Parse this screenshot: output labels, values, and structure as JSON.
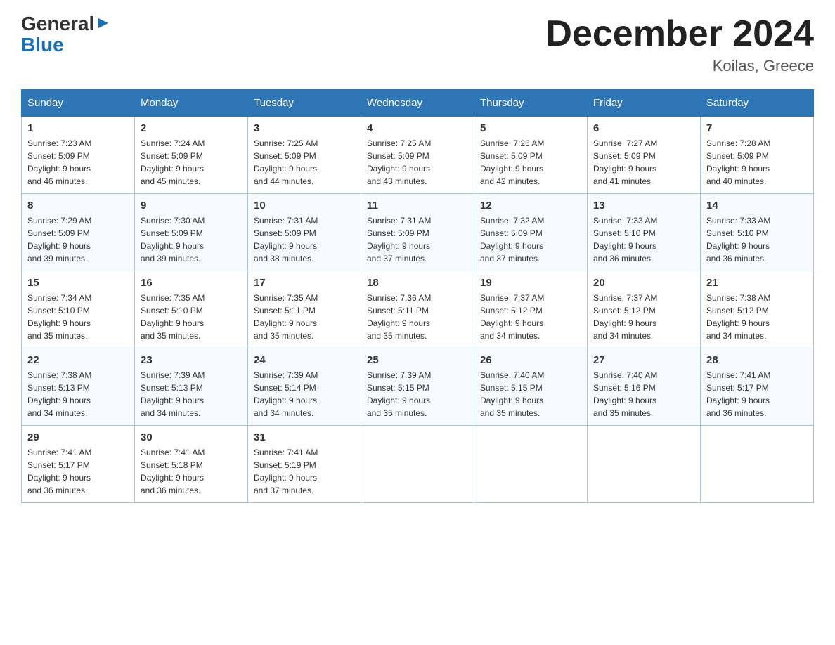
{
  "logo": {
    "part1": "General",
    "arrow": "▶",
    "part2": "Blue"
  },
  "title": "December 2024",
  "location": "Koilas, Greece",
  "days_of_week": [
    "Sunday",
    "Monday",
    "Tuesday",
    "Wednesday",
    "Thursday",
    "Friday",
    "Saturday"
  ],
  "weeks": [
    [
      {
        "day": "1",
        "sunrise": "7:23 AM",
        "sunset": "5:09 PM",
        "daylight": "9 hours and 46 minutes."
      },
      {
        "day": "2",
        "sunrise": "7:24 AM",
        "sunset": "5:09 PM",
        "daylight": "9 hours and 45 minutes."
      },
      {
        "day": "3",
        "sunrise": "7:25 AM",
        "sunset": "5:09 PM",
        "daylight": "9 hours and 44 minutes."
      },
      {
        "day": "4",
        "sunrise": "7:25 AM",
        "sunset": "5:09 PM",
        "daylight": "9 hours and 43 minutes."
      },
      {
        "day": "5",
        "sunrise": "7:26 AM",
        "sunset": "5:09 PM",
        "daylight": "9 hours and 42 minutes."
      },
      {
        "day": "6",
        "sunrise": "7:27 AM",
        "sunset": "5:09 PM",
        "daylight": "9 hours and 41 minutes."
      },
      {
        "day": "7",
        "sunrise": "7:28 AM",
        "sunset": "5:09 PM",
        "daylight": "9 hours and 40 minutes."
      }
    ],
    [
      {
        "day": "8",
        "sunrise": "7:29 AM",
        "sunset": "5:09 PM",
        "daylight": "9 hours and 39 minutes."
      },
      {
        "day": "9",
        "sunrise": "7:30 AM",
        "sunset": "5:09 PM",
        "daylight": "9 hours and 39 minutes."
      },
      {
        "day": "10",
        "sunrise": "7:31 AM",
        "sunset": "5:09 PM",
        "daylight": "9 hours and 38 minutes."
      },
      {
        "day": "11",
        "sunrise": "7:31 AM",
        "sunset": "5:09 PM",
        "daylight": "9 hours and 37 minutes."
      },
      {
        "day": "12",
        "sunrise": "7:32 AM",
        "sunset": "5:09 PM",
        "daylight": "9 hours and 37 minutes."
      },
      {
        "day": "13",
        "sunrise": "7:33 AM",
        "sunset": "5:10 PM",
        "daylight": "9 hours and 36 minutes."
      },
      {
        "day": "14",
        "sunrise": "7:33 AM",
        "sunset": "5:10 PM",
        "daylight": "9 hours and 36 minutes."
      }
    ],
    [
      {
        "day": "15",
        "sunrise": "7:34 AM",
        "sunset": "5:10 PM",
        "daylight": "9 hours and 35 minutes."
      },
      {
        "day": "16",
        "sunrise": "7:35 AM",
        "sunset": "5:10 PM",
        "daylight": "9 hours and 35 minutes."
      },
      {
        "day": "17",
        "sunrise": "7:35 AM",
        "sunset": "5:11 PM",
        "daylight": "9 hours and 35 minutes."
      },
      {
        "day": "18",
        "sunrise": "7:36 AM",
        "sunset": "5:11 PM",
        "daylight": "9 hours and 35 minutes."
      },
      {
        "day": "19",
        "sunrise": "7:37 AM",
        "sunset": "5:12 PM",
        "daylight": "9 hours and 34 minutes."
      },
      {
        "day": "20",
        "sunrise": "7:37 AM",
        "sunset": "5:12 PM",
        "daylight": "9 hours and 34 minutes."
      },
      {
        "day": "21",
        "sunrise": "7:38 AM",
        "sunset": "5:12 PM",
        "daylight": "9 hours and 34 minutes."
      }
    ],
    [
      {
        "day": "22",
        "sunrise": "7:38 AM",
        "sunset": "5:13 PM",
        "daylight": "9 hours and 34 minutes."
      },
      {
        "day": "23",
        "sunrise": "7:39 AM",
        "sunset": "5:13 PM",
        "daylight": "9 hours and 34 minutes."
      },
      {
        "day": "24",
        "sunrise": "7:39 AM",
        "sunset": "5:14 PM",
        "daylight": "9 hours and 34 minutes."
      },
      {
        "day": "25",
        "sunrise": "7:39 AM",
        "sunset": "5:15 PM",
        "daylight": "9 hours and 35 minutes."
      },
      {
        "day": "26",
        "sunrise": "7:40 AM",
        "sunset": "5:15 PM",
        "daylight": "9 hours and 35 minutes."
      },
      {
        "day": "27",
        "sunrise": "7:40 AM",
        "sunset": "5:16 PM",
        "daylight": "9 hours and 35 minutes."
      },
      {
        "day": "28",
        "sunrise": "7:41 AM",
        "sunset": "5:17 PM",
        "daylight": "9 hours and 36 minutes."
      }
    ],
    [
      {
        "day": "29",
        "sunrise": "7:41 AM",
        "sunset": "5:17 PM",
        "daylight": "9 hours and 36 minutes."
      },
      {
        "day": "30",
        "sunrise": "7:41 AM",
        "sunset": "5:18 PM",
        "daylight": "9 hours and 36 minutes."
      },
      {
        "day": "31",
        "sunrise": "7:41 AM",
        "sunset": "5:19 PM",
        "daylight": "9 hours and 37 minutes."
      },
      null,
      null,
      null,
      null
    ]
  ],
  "labels": {
    "sunrise": "Sunrise:",
    "sunset": "Sunset:",
    "daylight": "Daylight:"
  }
}
